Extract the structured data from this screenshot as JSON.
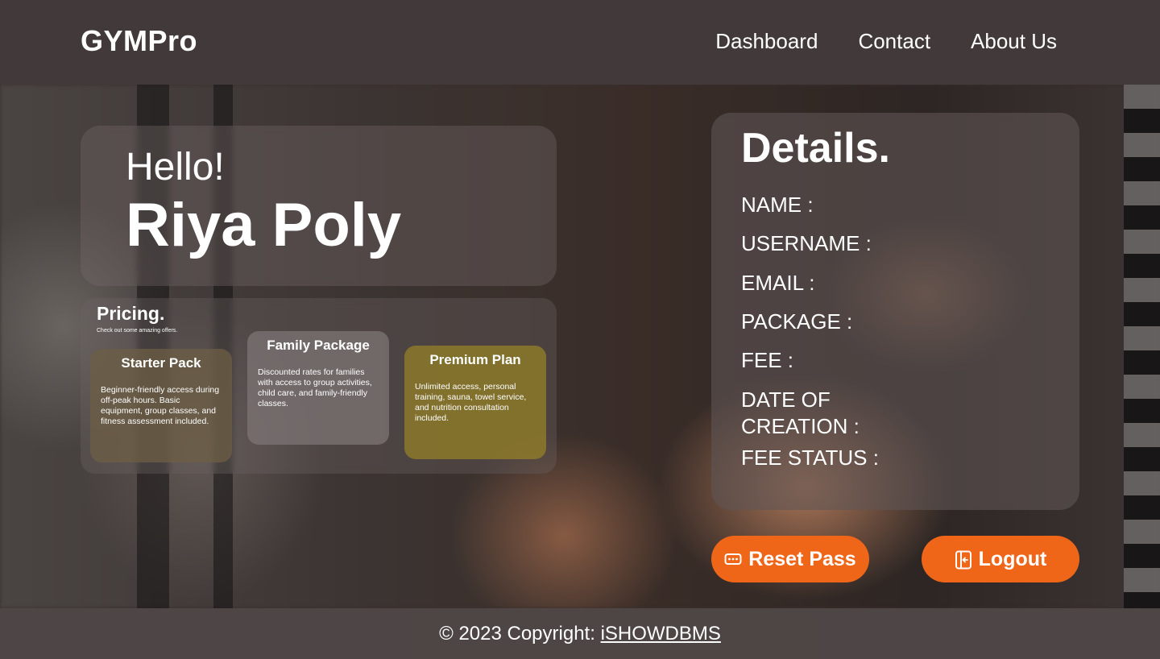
{
  "header": {
    "brand": "GYMPro",
    "nav": [
      "Dashboard",
      "Contact",
      "About Us"
    ]
  },
  "greeting": {
    "hello": "Hello!",
    "name": "Riya Poly"
  },
  "pricing": {
    "title": "Pricing.",
    "subtitle": "Check out some amazing offers.",
    "plans": [
      {
        "name": "Starter Pack",
        "description": "Beginner-friendly access during off-peak hours. Basic equipment, group classes, and fitness assessment included."
      },
      {
        "name": "Family Package",
        "description": "Discounted rates for families with access to group activities, child care, and family-friendly classes."
      },
      {
        "name": "Premium Plan",
        "description": "Unlimited access, personal training, sauna, towel service, and nutrition consultation included."
      }
    ]
  },
  "details": {
    "title": "Details.",
    "fields": [
      "NAME :",
      "USERNAME :",
      "EMAIL  :",
      "PACKAGE  :",
      "FEE :",
      "DATE OF",
      "CREATION :",
      "FEE STATUS :"
    ]
  },
  "buttons": {
    "reset": "Reset Pass",
    "logout": "Logout"
  },
  "footer": {
    "copyright": "© 2023 Copyright: ",
    "link": "iSHOWDBMS"
  },
  "colors": {
    "accent": "#ef6619",
    "header_bg": "#423a3a"
  }
}
